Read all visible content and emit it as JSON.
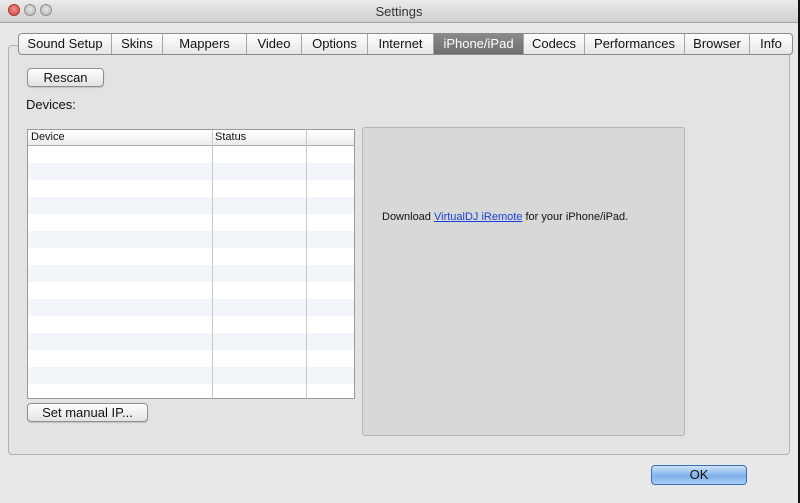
{
  "window": {
    "title": "Settings"
  },
  "tabs": [
    {
      "label": "Sound Setup",
      "active": false
    },
    {
      "label": "Skins",
      "active": false
    },
    {
      "label": "Mappers",
      "active": false
    },
    {
      "label": "Video",
      "active": false
    },
    {
      "label": "Options",
      "active": false
    },
    {
      "label": "Internet",
      "active": false
    },
    {
      "label": "iPhone/iPad",
      "active": true
    },
    {
      "label": "Codecs",
      "active": false
    },
    {
      "label": "Performances",
      "active": false
    },
    {
      "label": "Browser",
      "active": false
    },
    {
      "label": "Info",
      "active": false
    }
  ],
  "devices_panel": {
    "rescan_label": "Rescan",
    "devices_label": "Devices:",
    "columns": [
      "Device",
      "Status",
      ""
    ],
    "set_manual_ip_label": "Set manual IP..."
  },
  "info": {
    "prefix": "Download ",
    "link_text": "VirtualDJ iRemote",
    "suffix": " for your iPhone/iPad."
  },
  "footer": {
    "ok_label": "OK"
  },
  "colors": {
    "active_tab": "#7a7a7a",
    "link": "#1a3fd6",
    "ok_button": "#7fb1ec"
  }
}
